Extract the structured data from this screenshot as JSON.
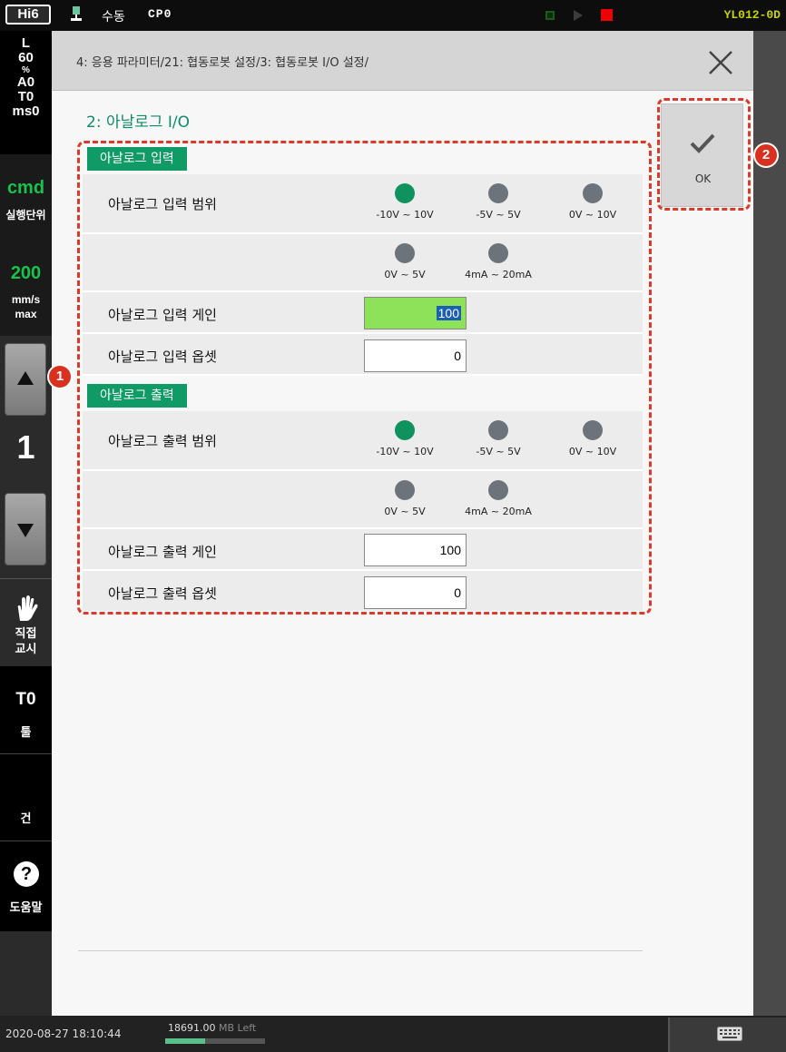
{
  "topbar": {
    "logo": "Hi6",
    "mode_icon": "pendant-icon",
    "mode": "수동",
    "cp": "CP0",
    "version": "YL012-0D"
  },
  "sidebar": {
    "info": [
      "L",
      "60",
      "%",
      "A0",
      "T0",
      "ms0"
    ],
    "cmd": "cmd",
    "cmd_label": "실행단위",
    "speed": "200",
    "speed_unit_1": "mm/s",
    "speed_unit_2": "max",
    "step": "1",
    "direct_label_1": "직접",
    "direct_label_2": "교시",
    "tool": "T0",
    "tool_label": "툴",
    "gun_label": "건",
    "help_label": "도움말"
  },
  "dialog": {
    "breadcrumb": "4: 응용 파라미터/21: 협동로봇 설정/3: 협동로봇 I/O 설정/",
    "title": "2: 아날로그 I/O",
    "ok_label": "OK",
    "input": {
      "section": "아날로그 입력",
      "range_label": "아날로그 입력 범위",
      "ranges": [
        "-10V ~ 10V",
        "-5V ~ 5V",
        "0V ~ 10V",
        "0V ~ 5V",
        "4mA ~ 20mA"
      ],
      "selected_range": "-10V ~ 10V",
      "gain_label": "아날로그 입력 게인",
      "gain_value": "100",
      "offset_label": "아날로그 입력 옵셋",
      "offset_value": "0"
    },
    "output": {
      "section": "아날로그 출력",
      "range_label": "아날로그 출력 범위",
      "ranges": [
        "-10V ~ 10V",
        "-5V ~ 5V",
        "0V ~ 10V",
        "0V ~ 5V",
        "4mA ~ 20mA"
      ],
      "selected_range": "-10V ~ 10V",
      "gain_label": "아날로그 출력 게인",
      "gain_value": "100",
      "offset_label": "아날로그 출력 옵셋",
      "offset_value": "0"
    },
    "badges": [
      "1",
      "2"
    ]
  },
  "bottombar": {
    "datetime": "2020-08-27 18:10:44",
    "memory": "18691.00",
    "memory_unit": "MB Left",
    "memory_fraction": 0.4
  },
  "colors": {
    "accent_green": "#109a66",
    "radio_selected": "#10925f",
    "radio_unselected": "#6c737b",
    "highlight_dash": "#d93b2b",
    "active_field": "#8ee25a"
  }
}
